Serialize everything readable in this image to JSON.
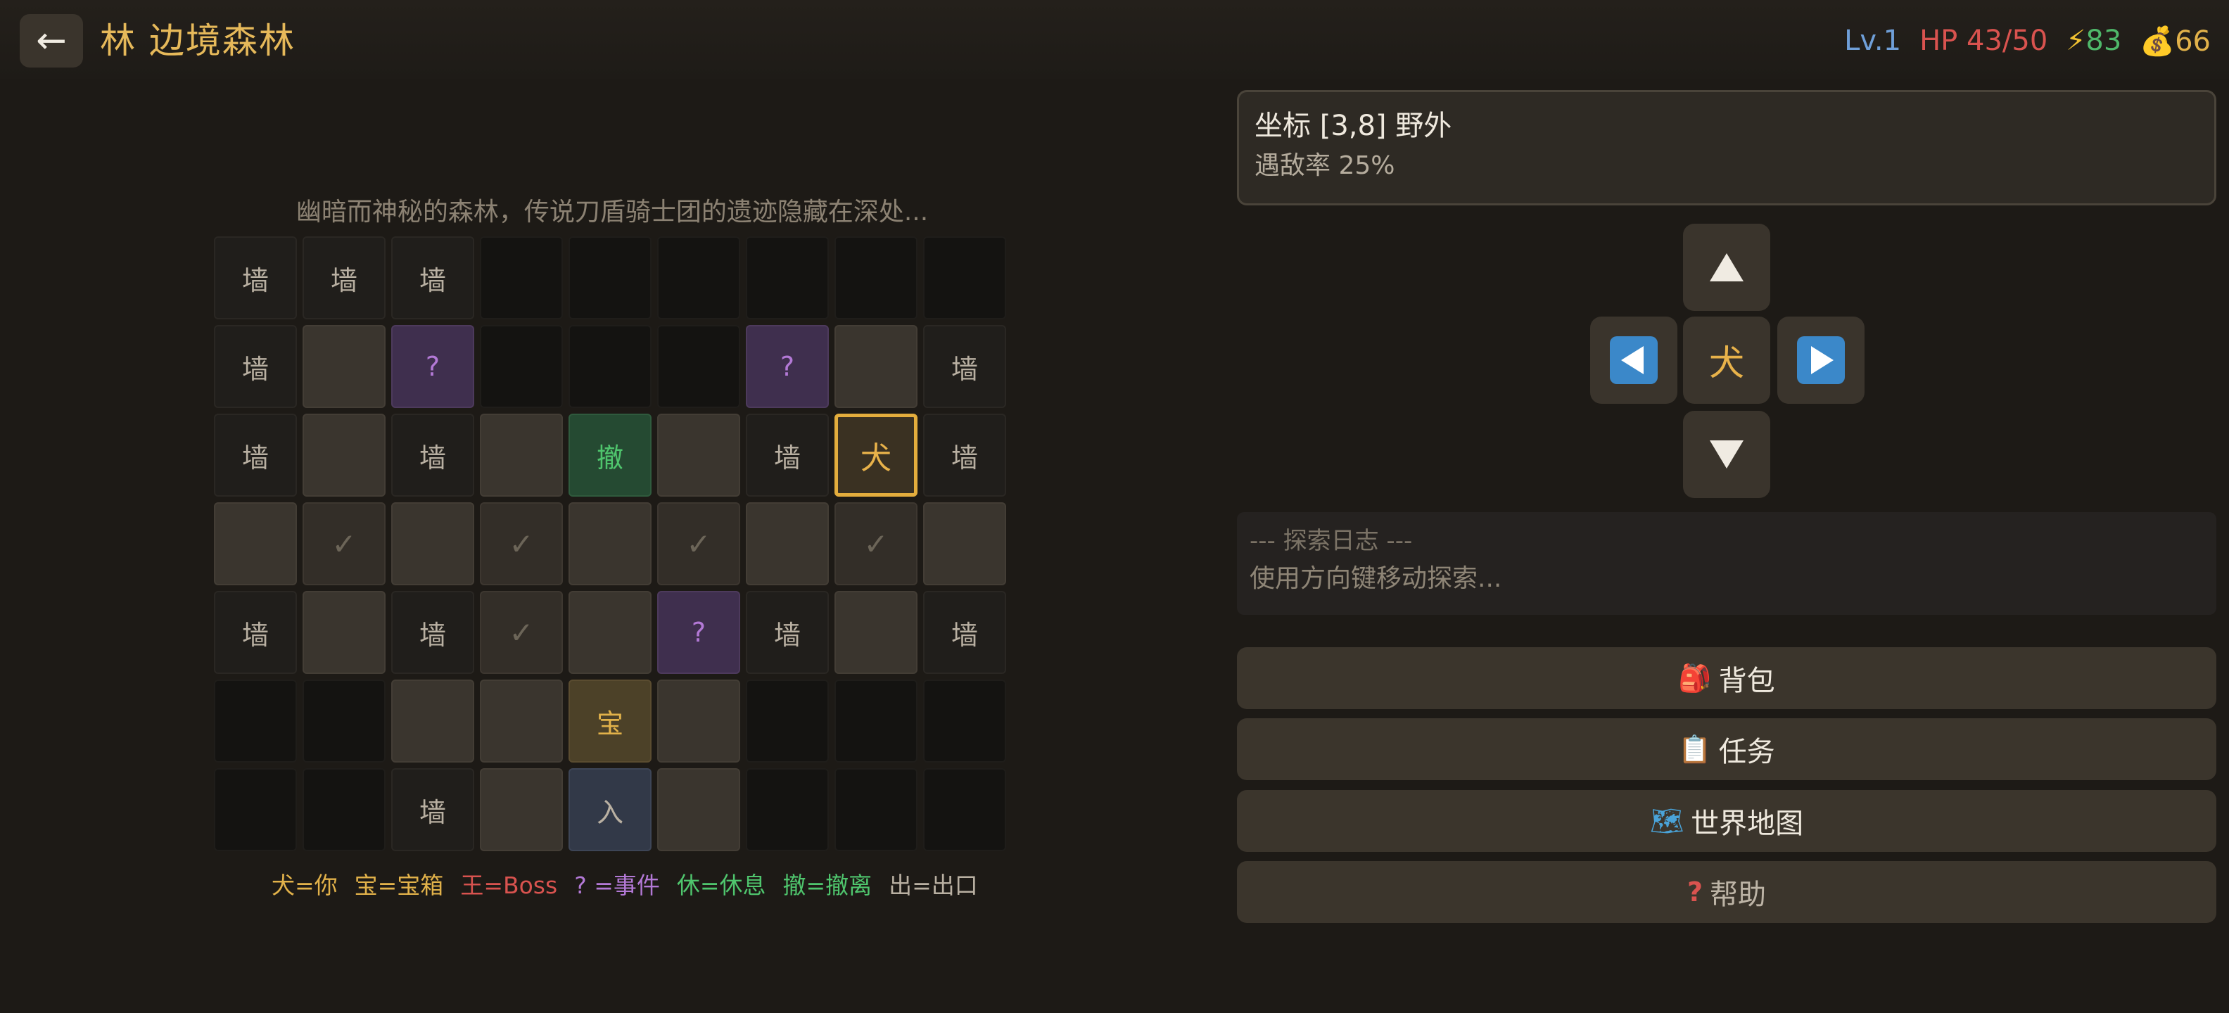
{
  "header": {
    "back_icon": "←",
    "title": "林 边境森林",
    "level": "Lv.1",
    "hp": "HP 43/50",
    "energy_icon": "⚡",
    "energy": "83",
    "gold_icon": "💰",
    "gold": "66"
  },
  "map": {
    "description": "幽暗而神秘的森林，传说刀盾骑士团的遗迹隐藏在深处...",
    "rows": [
      [
        {
          "t": "wall",
          "s": "墙"
        },
        {
          "t": "wall",
          "s": "墙"
        },
        {
          "t": "wall",
          "s": "墙"
        },
        {
          "t": "dark",
          "s": ""
        },
        {
          "t": "dark",
          "s": ""
        },
        {
          "t": "dark",
          "s": ""
        },
        {
          "t": "dark",
          "s": ""
        },
        {
          "t": "dark",
          "s": ""
        },
        {
          "t": "dark",
          "s": ""
        }
      ],
      [
        {
          "t": "wall",
          "s": "墙"
        },
        {
          "t": "floor",
          "s": ""
        },
        {
          "t": "event",
          "s": "?"
        },
        {
          "t": "dark",
          "s": ""
        },
        {
          "t": "dark",
          "s": ""
        },
        {
          "t": "dark",
          "s": ""
        },
        {
          "t": "event",
          "s": "?"
        },
        {
          "t": "floor",
          "s": ""
        },
        {
          "t": "wall",
          "s": "墙"
        }
      ],
      [
        {
          "t": "wall",
          "s": "墙"
        },
        {
          "t": "floor",
          "s": ""
        },
        {
          "t": "wall",
          "s": "墙"
        },
        {
          "t": "floor",
          "s": ""
        },
        {
          "t": "retreat",
          "s": "撤"
        },
        {
          "t": "floor",
          "s": ""
        },
        {
          "t": "wall",
          "s": "墙"
        },
        {
          "t": "player",
          "s": "犬"
        },
        {
          "t": "wall",
          "s": "墙"
        }
      ],
      [
        {
          "t": "floor",
          "s": ""
        },
        {
          "t": "visited",
          "s": "✓"
        },
        {
          "t": "floor",
          "s": ""
        },
        {
          "t": "visited",
          "s": "✓"
        },
        {
          "t": "floor",
          "s": ""
        },
        {
          "t": "visited",
          "s": "✓"
        },
        {
          "t": "floor",
          "s": ""
        },
        {
          "t": "visited",
          "s": "✓"
        },
        {
          "t": "floor",
          "s": ""
        }
      ],
      [
        {
          "t": "wall",
          "s": "墙"
        },
        {
          "t": "floor",
          "s": ""
        },
        {
          "t": "wall",
          "s": "墙"
        },
        {
          "t": "visited",
          "s": "✓"
        },
        {
          "t": "floor",
          "s": ""
        },
        {
          "t": "event",
          "s": "?"
        },
        {
          "t": "wall",
          "s": "墙"
        },
        {
          "t": "floor",
          "s": ""
        },
        {
          "t": "wall",
          "s": "墙"
        }
      ],
      [
        {
          "t": "dark",
          "s": ""
        },
        {
          "t": "dark",
          "s": ""
        },
        {
          "t": "floor",
          "s": ""
        },
        {
          "t": "floor",
          "s": ""
        },
        {
          "t": "treasure",
          "s": "宝"
        },
        {
          "t": "floor",
          "s": ""
        },
        {
          "t": "dark",
          "s": ""
        },
        {
          "t": "dark",
          "s": ""
        },
        {
          "t": "dark",
          "s": ""
        }
      ],
      [
        {
          "t": "dark",
          "s": ""
        },
        {
          "t": "dark",
          "s": ""
        },
        {
          "t": "wall",
          "s": "墙"
        },
        {
          "t": "floor",
          "s": ""
        },
        {
          "t": "entry",
          "s": "入"
        },
        {
          "t": "floor",
          "s": ""
        },
        {
          "t": "dark",
          "s": ""
        },
        {
          "t": "dark",
          "s": ""
        },
        {
          "t": "dark",
          "s": ""
        }
      ]
    ],
    "legend": {
      "you": "犬=你",
      "treasure": "宝=宝箱",
      "boss": "王=Boss",
      "event": "? =事件",
      "rest": "休=休息",
      "retreat": "撤=撤离",
      "exit": "出=出口"
    }
  },
  "location": {
    "coords": "坐标 [3,8]  野外",
    "encounter": "遇敌率 25%"
  },
  "dpad": {
    "center": "犬",
    "icons": {
      "up": "up-arrow-icon",
      "down": "down-arrow-icon",
      "left": "left-arrow-icon",
      "right": "right-arrow-icon"
    }
  },
  "log": {
    "title": "--- 探索日志 ---",
    "line": "使用方向键移动探索..."
  },
  "menu": {
    "backpack_icon": "🎒",
    "backpack": "背包",
    "tasks_icon": "📋",
    "tasks": "任务",
    "worldmap_icon": "🗺",
    "worldmap": "世界地图",
    "help_icon": "?",
    "help": "帮助"
  }
}
